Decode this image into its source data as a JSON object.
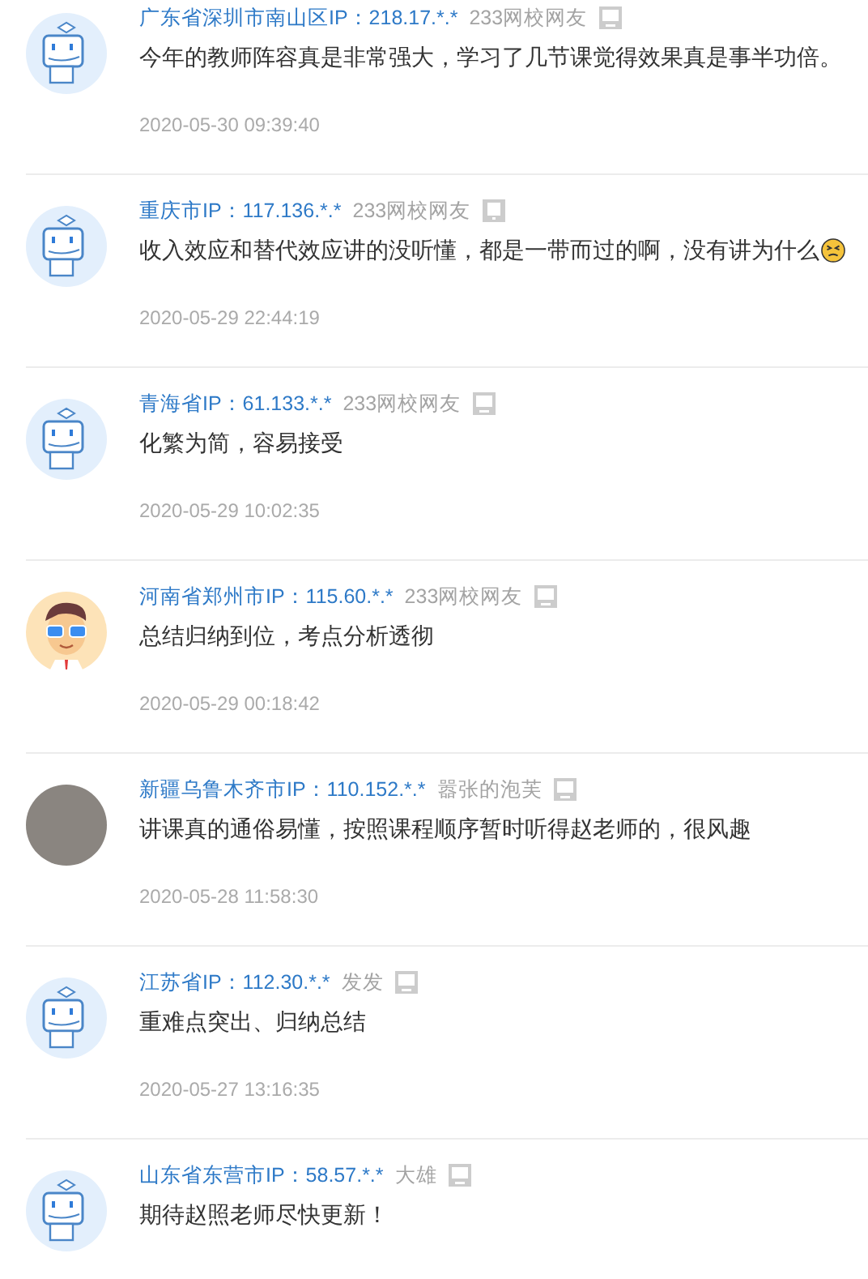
{
  "comments": [
    {
      "avatar": {
        "kind": "robot"
      },
      "location": "广东省深圳市南山区IP：218.17.*.*",
      "user": "233网校网友",
      "device": {
        "kind": "pc"
      },
      "text": "今年的教师阵容真是非常强大，学习了几节课觉得效果真是事半功倍。",
      "trailing_emoji": false,
      "time": "2020-05-30 09:39:40"
    },
    {
      "avatar": {
        "kind": "robot"
      },
      "location": "重庆市IP：117.136.*.*",
      "user": "233网校网友",
      "device": {
        "kind": "mobile"
      },
      "text": "收入效应和替代效应讲的没听懂，都是一带而过的啊，没有讲为什么",
      "trailing_emoji": true,
      "time": "2020-05-29 22:44:19"
    },
    {
      "avatar": {
        "kind": "robot"
      },
      "location": "青海省IP：61.133.*.*",
      "user": "233网校网友",
      "device": {
        "kind": "pc"
      },
      "text": "化繁为简，容易接受",
      "trailing_emoji": false,
      "time": "2020-05-29 10:02:35"
    },
    {
      "avatar": {
        "kind": "cartoon"
      },
      "location": "河南省郑州市IP：115.60.*.*",
      "user": "233网校网友",
      "device": {
        "kind": "pc"
      },
      "text": "总结归纳到位，考点分析透彻",
      "trailing_emoji": false,
      "time": "2020-05-29 00:18:42"
    },
    {
      "avatar": {
        "kind": "photo"
      },
      "location": "新疆乌鲁木齐市IP：110.152.*.*",
      "user": "嚣张的泡芙",
      "device": {
        "kind": "pc"
      },
      "text": "讲课真的通俗易懂，按照课程顺序暂时听得赵老师的，很风趣",
      "trailing_emoji": false,
      "time": "2020-05-28 11:58:30"
    },
    {
      "avatar": {
        "kind": "robot"
      },
      "location": "江苏省IP：112.30.*.*",
      "user": "发发",
      "device": {
        "kind": "pc"
      },
      "text": "重难点突出、归纳总结",
      "trailing_emoji": false,
      "time": "2020-05-27 13:16:35"
    },
    {
      "avatar": {
        "kind": "robot"
      },
      "location": "山东省东营市IP：58.57.*.*",
      "user": "大雄",
      "device": {
        "kind": "pc"
      },
      "text": "期待赵照老师尽快更新！",
      "trailing_emoji": false
    }
  ]
}
